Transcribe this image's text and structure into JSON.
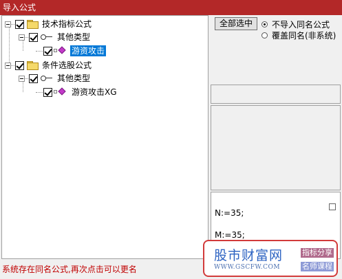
{
  "window": {
    "title": "导入公式"
  },
  "tree": {
    "groups": [
      {
        "label": "技术指标公式",
        "child": {
          "label": "其他类型",
          "item": {
            "label": "游资攻击"
          }
        }
      },
      {
        "label": "条件选股公式",
        "child": {
          "label": "其他类型",
          "item": {
            "label": "游资攻击XG"
          }
        }
      }
    ]
  },
  "options": {
    "select_all_label": "全部选中",
    "radio_skip_label": "不导入同名公式",
    "radio_overwrite_label": "覆盖同名(非系统)",
    "selected": "不导入同名公式"
  },
  "code": {
    "lines": [
      "N:=35;",
      "M:=35;"
    ]
  },
  "status": {
    "message": "系统存在同名公式,再次点击可以更名"
  },
  "watermark": {
    "title": "股市财富网",
    "url": "WWW.GSCFW.COM",
    "tag1": "指标分享",
    "tag2": "名师课程"
  },
  "colors": {
    "titlebar": "#b32828",
    "selection": "#0078d7",
    "status_text": "#c00000"
  }
}
